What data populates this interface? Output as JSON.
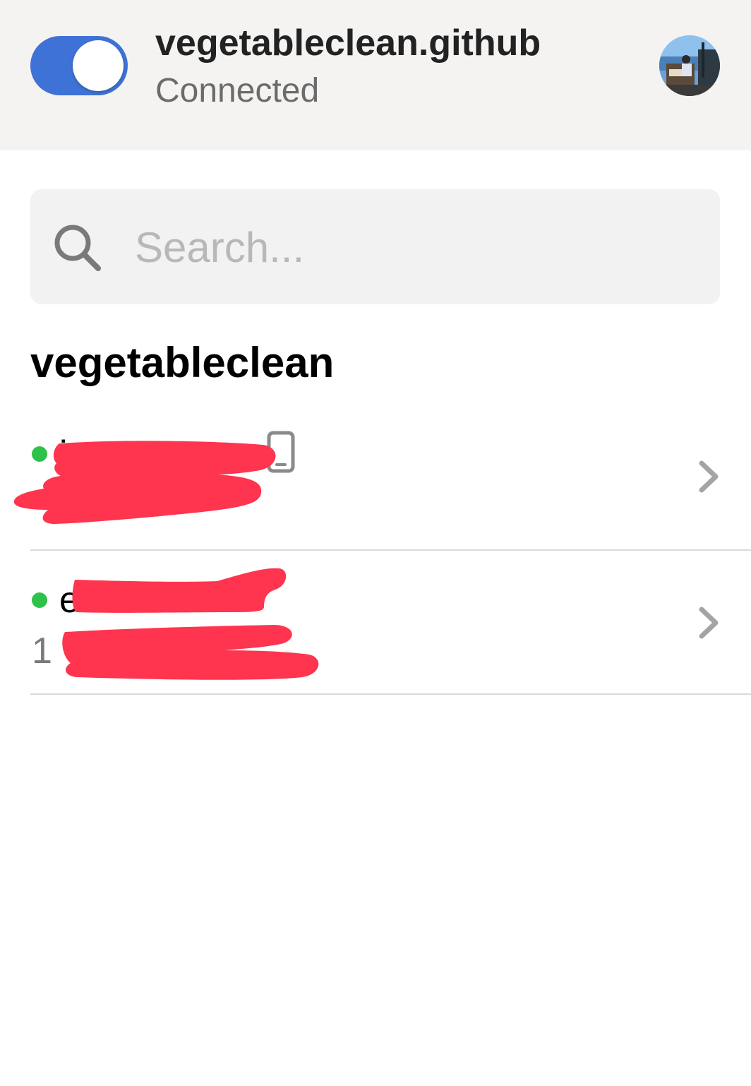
{
  "header": {
    "tailnet_name": "vegetableclean.github",
    "status": "Connected",
    "toggle_on": true,
    "accent_color": "#3f72d6"
  },
  "search": {
    "placeholder": "Search...",
    "value": ""
  },
  "section": {
    "title": "vegetableclean"
  },
  "devices": [
    {
      "name": "i",
      "ip": "",
      "online": true,
      "icon": "phone-icon"
    },
    {
      "name": "e",
      "ip": "1",
      "online": true,
      "icon": ""
    }
  ],
  "colors": {
    "online": "#2fc24a",
    "redaction": "#ff344e",
    "header_bg": "#f4f3f2"
  }
}
